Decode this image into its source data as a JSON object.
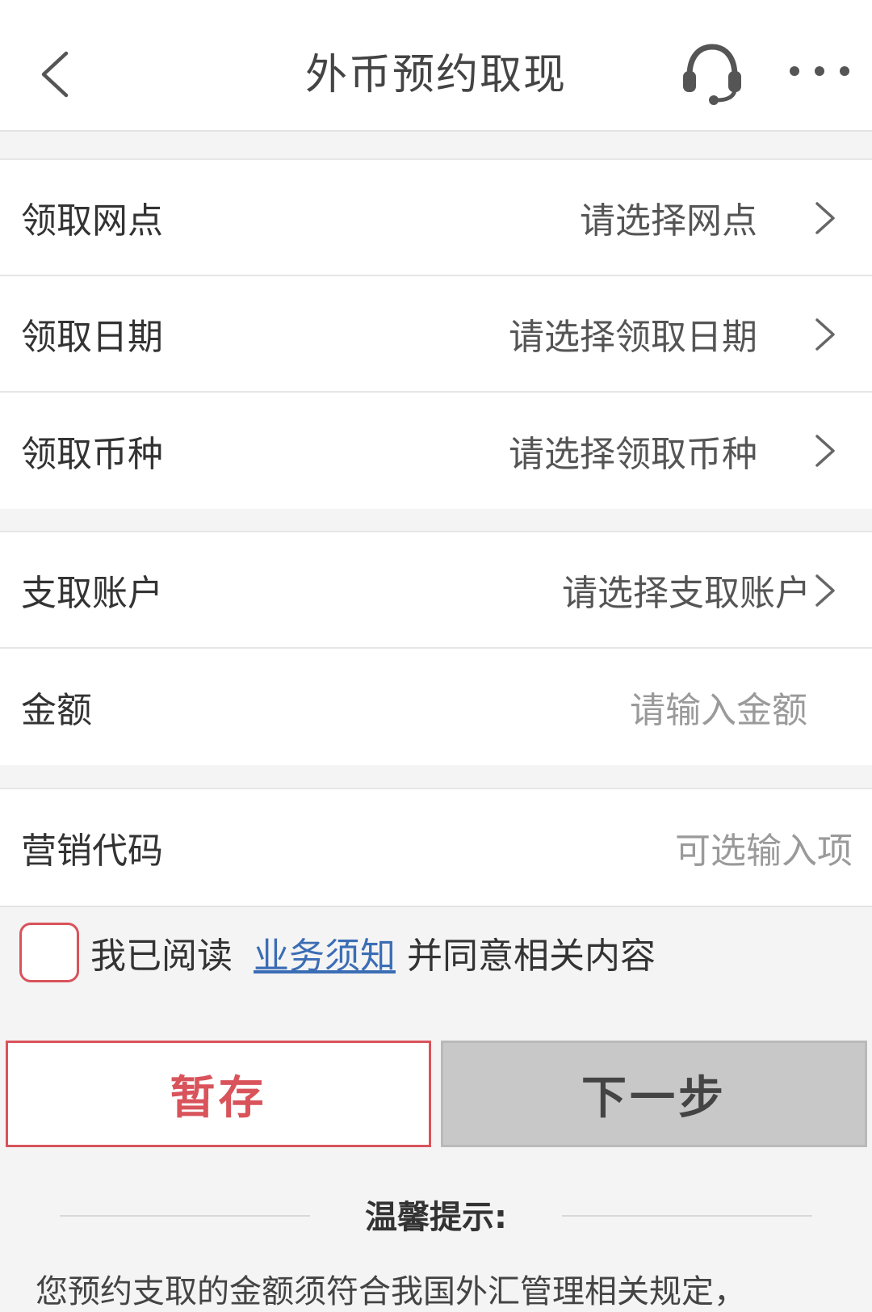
{
  "header": {
    "title": "外币预约取现",
    "icons": {
      "back": "back-arrow-icon",
      "service": "headset-icon",
      "more": "more-dots-icon"
    }
  },
  "form": {
    "group1": [
      {
        "label": "领取网点",
        "value": "请选择网点"
      },
      {
        "label": "领取日期",
        "value": "请选择领取日期"
      },
      {
        "label": "领取币种",
        "value": "请选择领取币种"
      }
    ],
    "group2": [
      {
        "label": "支取账户",
        "value": "请选择支取账户"
      },
      {
        "label": "金额",
        "placeholder": "请输入金额"
      }
    ],
    "group3": [
      {
        "label": "营销代码",
        "placeholder": "可选输入项"
      }
    ]
  },
  "agreement": {
    "prefix": "我已阅读",
    "link": "业务须知",
    "suffix": "并同意相关内容"
  },
  "buttons": {
    "save": "暂存",
    "next": "下一步"
  },
  "tips": {
    "title": "温馨提示:",
    "text": "您预约支取的金额须符合我国外汇管理相关规定，"
  },
  "colors": {
    "accent_red": "#d9535b",
    "link_blue": "#3b6db5",
    "disabled_gray": "#c8c8c8"
  }
}
